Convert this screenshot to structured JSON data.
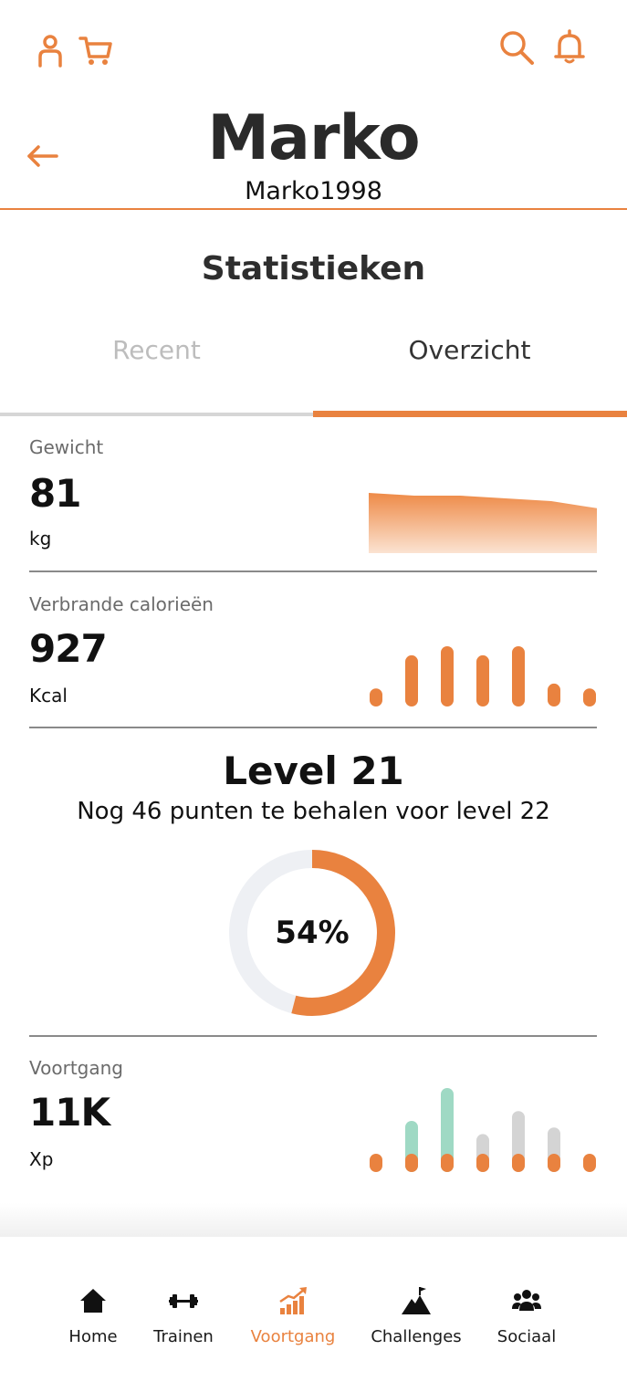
{
  "header": {
    "name": "Marko",
    "username": "Marko1998"
  },
  "section_title": "Statistieken",
  "tabs": [
    {
      "label": "Recent",
      "active": false
    },
    {
      "label": "Overzicht",
      "active": true
    }
  ],
  "stats": {
    "weight": {
      "label": "Gewicht",
      "value": "81",
      "unit": "kg"
    },
    "calories": {
      "label": "Verbrande calorieën",
      "value": "927",
      "unit": "Kcal"
    },
    "progress": {
      "label": "Voortgang",
      "value": "11K",
      "unit": "Xp"
    }
  },
  "level": {
    "title": "Level 21",
    "subtitle": "Nog 46 punten te behalen voor level 22",
    "percent_label": "54%",
    "percent": 0.54
  },
  "nav": [
    {
      "label": "Home",
      "icon": "home-icon",
      "active": false
    },
    {
      "label": "Trainen",
      "icon": "dumbbell-icon",
      "active": false
    },
    {
      "label": "Voortgang",
      "icon": "progress-chart-icon",
      "active": true
    },
    {
      "label": "Challenges",
      "icon": "mountain-flag-icon",
      "active": false
    },
    {
      "label": "Sociaal",
      "icon": "group-icon",
      "active": false
    }
  ],
  "colors": {
    "accent": "#e9823f",
    "teal": "#9fd9c4",
    "grey_bar": "#d4d4d4"
  },
  "chart_data": [
    {
      "type": "area",
      "series": [
        {
          "values": [
            100,
            95,
            95,
            90,
            85,
            72
          ]
        }
      ],
      "grid": false
    },
    {
      "type": "bar",
      "series": [
        {
          "values": [
            30,
            85,
            100,
            85,
            100,
            38,
            30
          ]
        }
      ],
      "grid": false
    },
    {
      "type": "bar",
      "series": [
        {
          "values": [
            0,
            0,
            0,
            0,
            0,
            0,
            0
          ]
        },
        {
          "values": [
            0,
            50,
            100,
            30,
            65,
            40,
            0
          ]
        }
      ],
      "grid": false
    }
  ]
}
